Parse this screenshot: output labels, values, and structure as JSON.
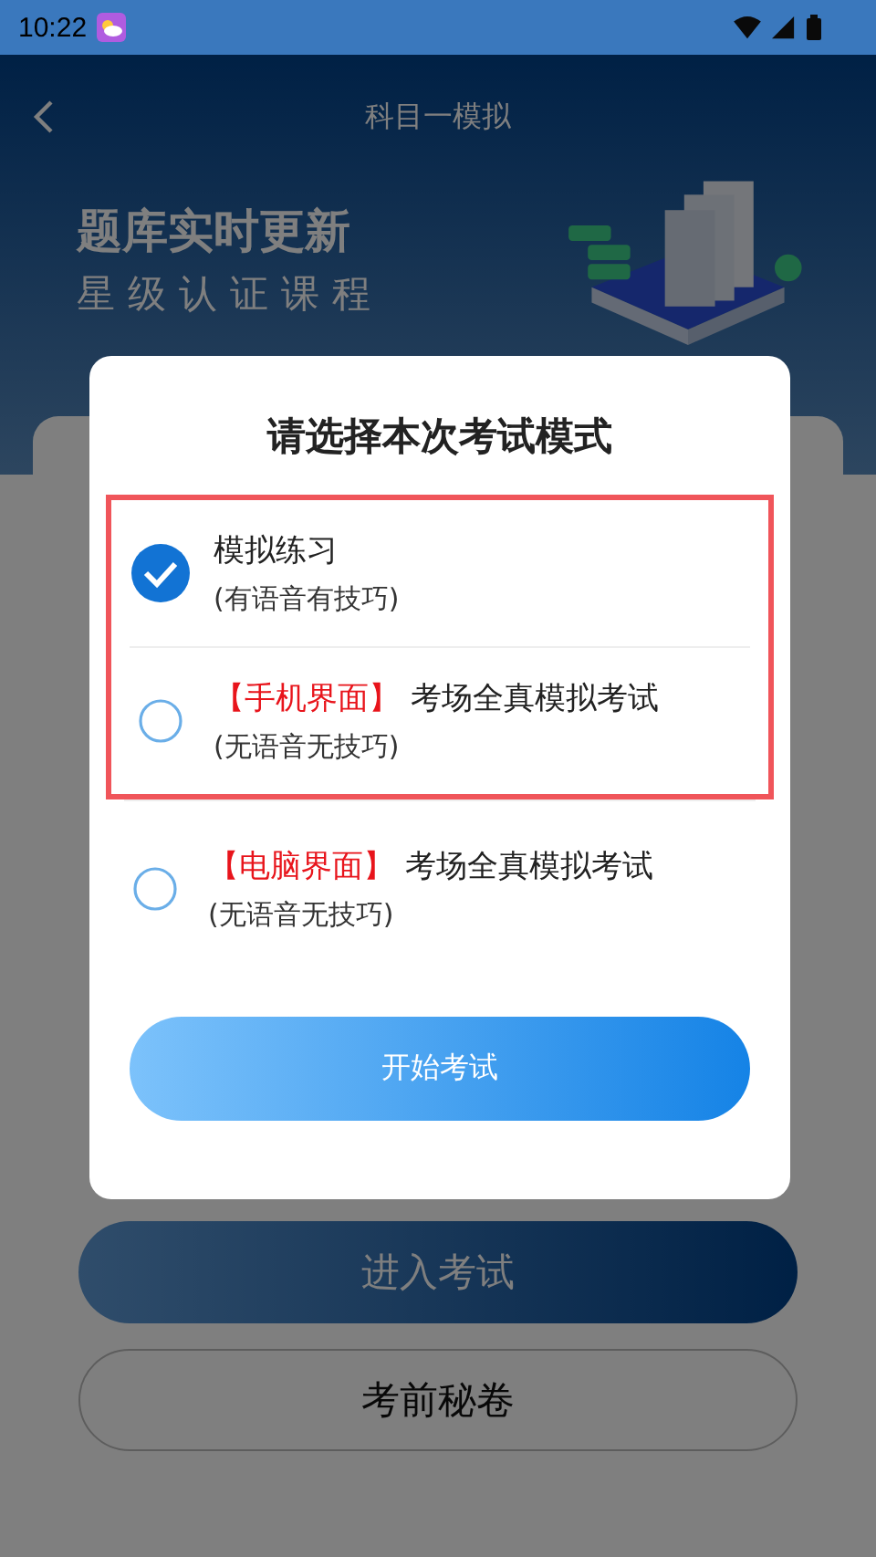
{
  "status_bar": {
    "time": "10:22"
  },
  "header": {
    "title": "科目一模拟"
  },
  "banner": {
    "headline": "题库实时更新",
    "tagline": "星级认证课程"
  },
  "page_buttons": [
    {
      "label": "进入考试",
      "kind": "primary"
    },
    {
      "label": "考前秘卷",
      "kind": "outline"
    }
  ],
  "dialog": {
    "title": "请选择本次考试模式",
    "highlighted_options": [
      {
        "title": "模拟练习",
        "subtitle": "(有语音有技巧)",
        "selected": true
      },
      {
        "tag": "【手机界面】",
        "title": "考场全真模拟考试",
        "subtitle": "(无语音无技巧)",
        "selected": false
      }
    ],
    "options": [
      {
        "tag": "【电脑界面】",
        "title": "考场全真模拟考试",
        "subtitle": "(无语音无技巧)",
        "selected": false
      }
    ],
    "start_button": "开始考试"
  }
}
